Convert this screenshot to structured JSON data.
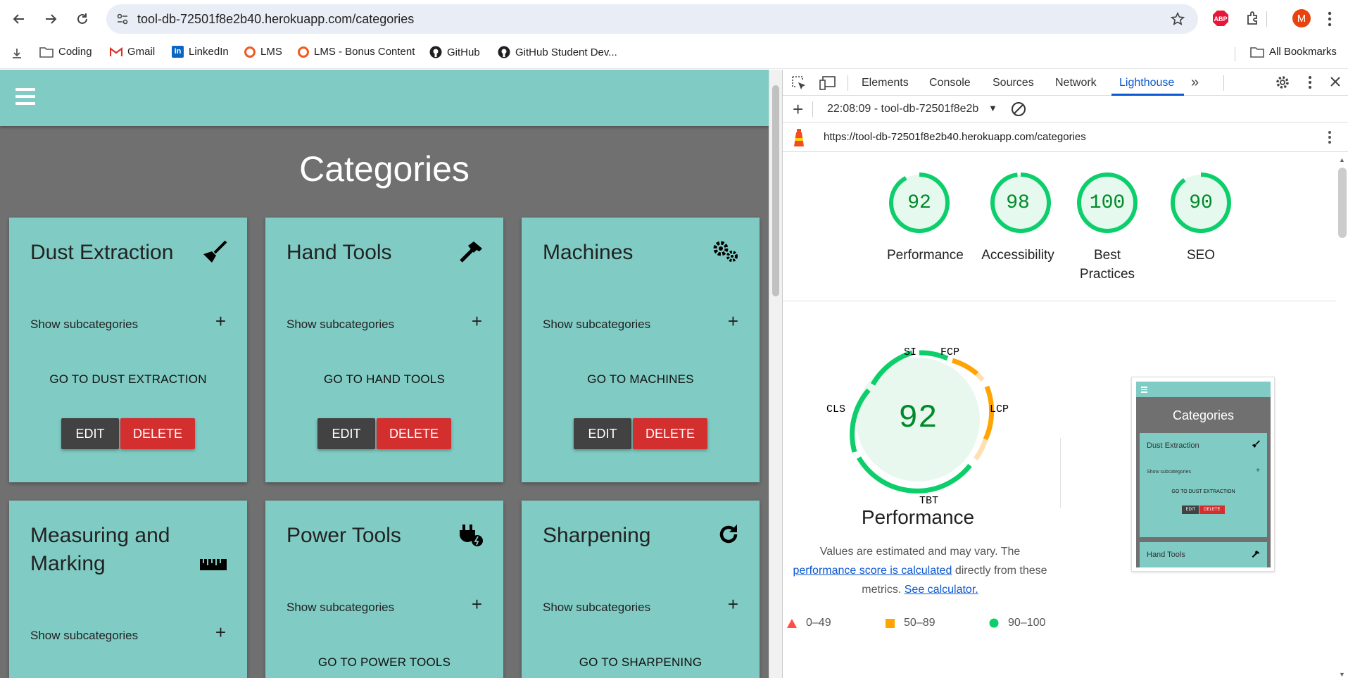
{
  "browser": {
    "url": "tool-db-72501f8e2b40.herokuapp.com/categories",
    "profile_initial": "M",
    "bookmarks": [
      "Coding",
      "Gmail",
      "LinkedIn",
      "LMS",
      "LMS - Bonus Content",
      "GitHub",
      "GitHub Student Dev..."
    ],
    "all_bookmarks": "All Bookmarks"
  },
  "page": {
    "title": "Categories",
    "cards": [
      {
        "title": "Dust Extraction",
        "icon": "broom-icon",
        "show_sub": "Show subcategories",
        "go": "GO TO DUST EXTRACTION",
        "edit": "EDIT",
        "delete": "DELETE"
      },
      {
        "title": "Hand Tools",
        "icon": "hammer-icon",
        "show_sub": "Show subcategories",
        "go": "GO TO HAND TOOLS",
        "edit": "EDIT",
        "delete": "DELETE"
      },
      {
        "title": "Machines",
        "icon": "gears-icon",
        "show_sub": "Show subcategories",
        "go": "GO TO MACHINES",
        "edit": "EDIT",
        "delete": "DELETE"
      },
      {
        "title": "Measuring and Marking",
        "icon": "ruler-icon",
        "show_sub": "Show subcategories"
      },
      {
        "title": "Power Tools",
        "icon": "plug-icon",
        "show_sub": "Show subcategories",
        "go": "GO TO POWER TOOLS"
      },
      {
        "title": "Sharpening",
        "icon": "rotate-icon",
        "show_sub": "Show subcategories",
        "go": "GO TO SHARPENING"
      }
    ]
  },
  "devtools": {
    "tabs": [
      "Elements",
      "Console",
      "Sources",
      "Network",
      "Lighthouse"
    ],
    "active_tab": "Lighthouse",
    "report_select": "22:08:09 - tool-db-72501f8e2b",
    "report_url": "https://tool-db-72501f8e2b40.herokuapp.com/categories",
    "scores": [
      {
        "label": "Performance",
        "value": 92
      },
      {
        "label": "Accessibility",
        "value": 98
      },
      {
        "label": "Best Practices",
        "value": 100
      },
      {
        "label": "SEO",
        "value": 90
      }
    ],
    "perf": {
      "score": 92,
      "title": "Performance",
      "metrics": [
        "SI",
        "FCP",
        "LCP",
        "TBT",
        "CLS"
      ],
      "desc_1": "Values are estimated and may vary. The",
      "desc_link": "performance score is calculated",
      "desc_2": "directly from these metrics.",
      "desc_link2": "See calculator."
    },
    "legend": [
      "0–49",
      "50–89",
      "90–100"
    ],
    "thumb": {
      "title": "Categories",
      "card1": "Dust Extraction",
      "show_sub": "Show subcategories",
      "go": "GO TO DUST EXTRACTION",
      "edit": "EDIT",
      "delete": "DELETE",
      "card2": "Hand Tools"
    },
    "colors": {
      "pass": "#0cce6b",
      "average": "#ffa400",
      "fail": "#ff4e42"
    }
  }
}
